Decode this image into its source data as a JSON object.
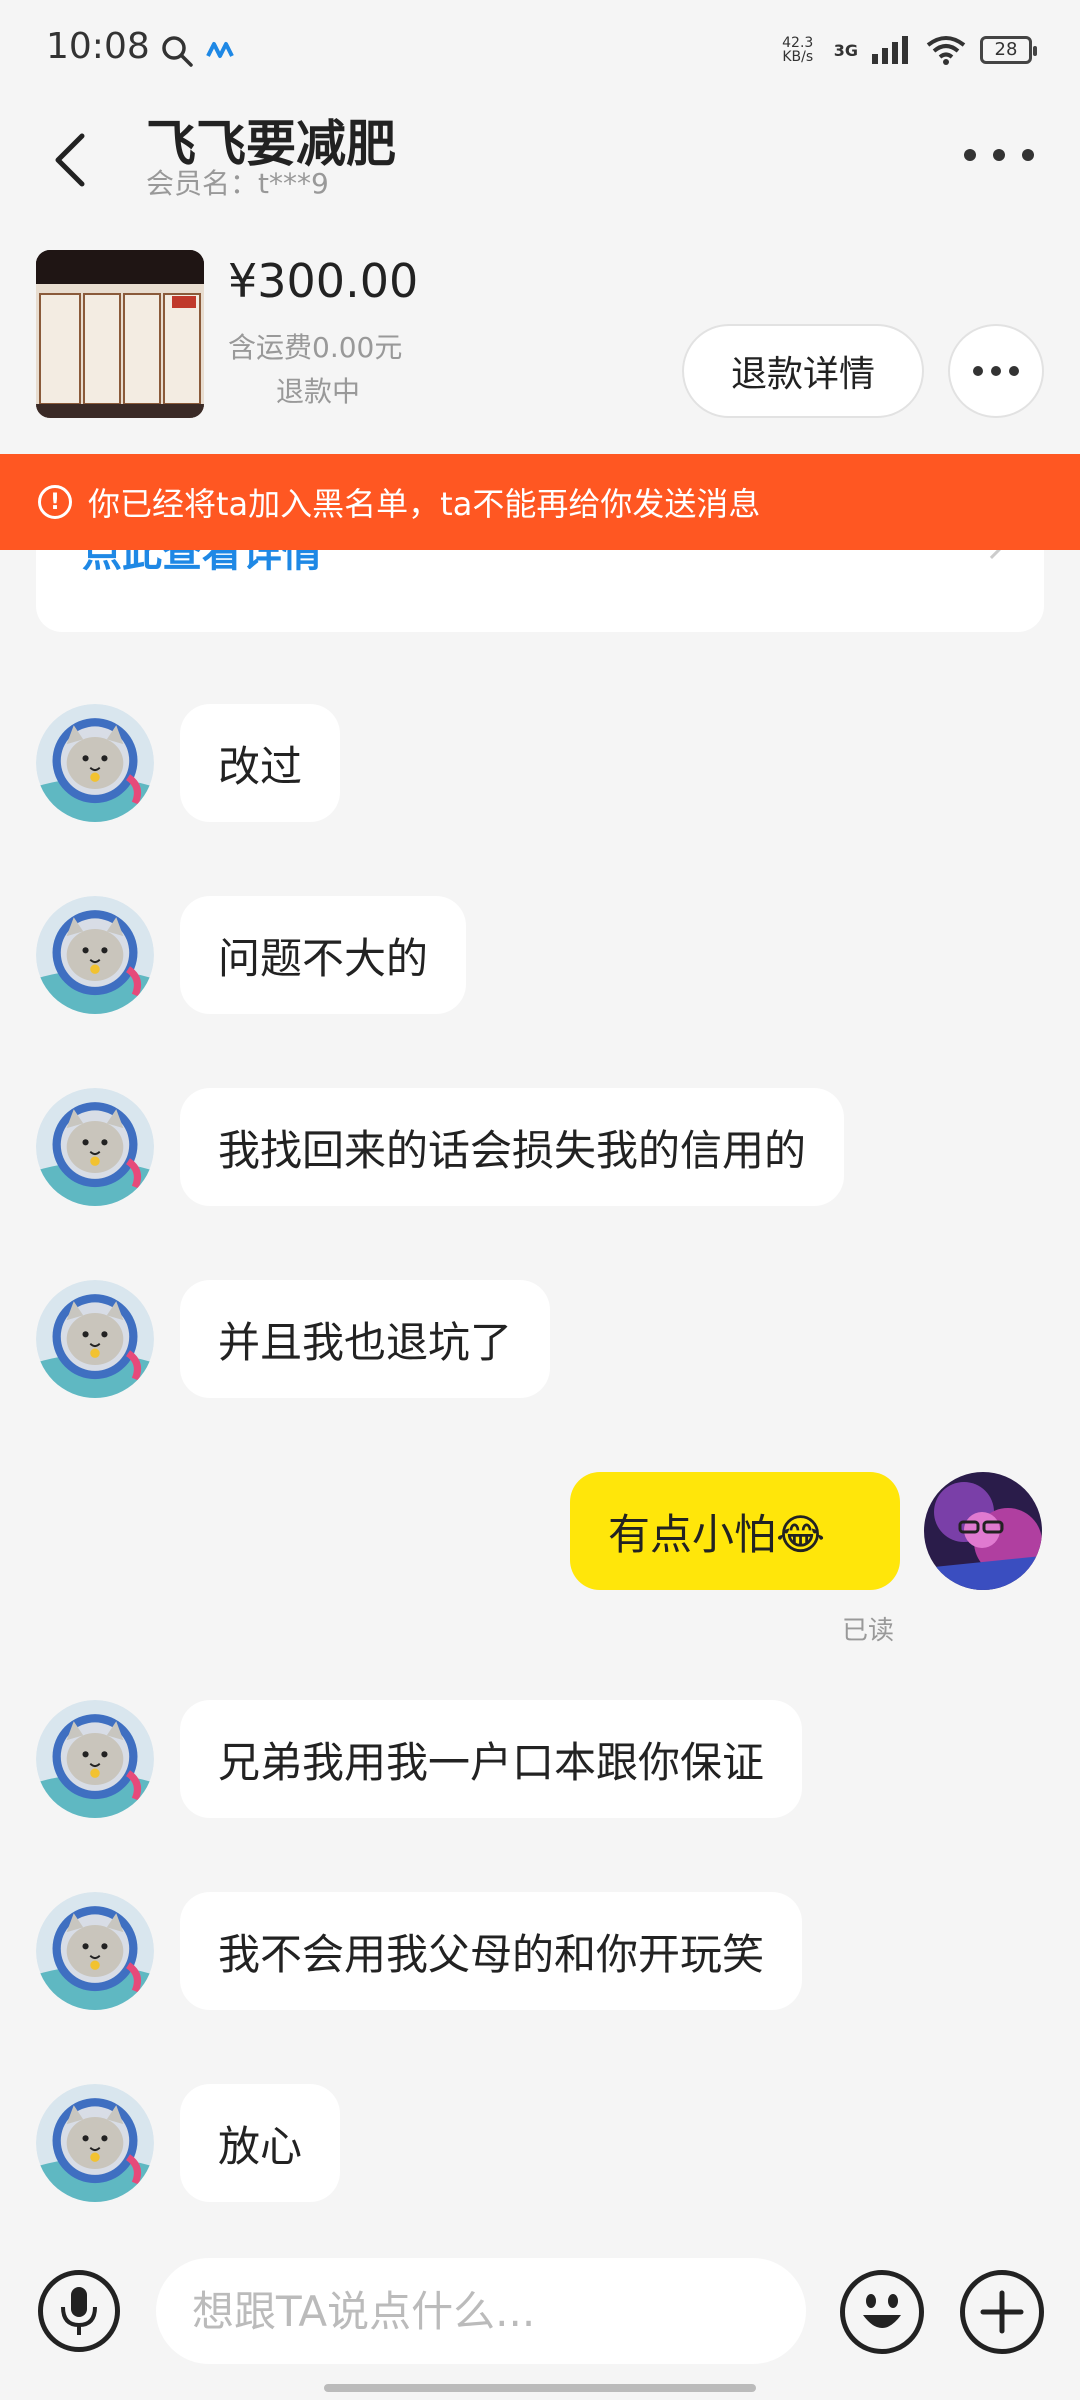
{
  "status_bar": {
    "time": "10:08",
    "net_speed_value": "42.3",
    "net_speed_unit": "KB/s",
    "network": "3G",
    "battery": "28"
  },
  "header": {
    "title": "飞飞要减肥",
    "subtitle": "会员名：t***9"
  },
  "product": {
    "price": "¥300.00",
    "shipping": "含运费0.00元",
    "status": "退款中",
    "refund_button": "退款详情"
  },
  "banner": {
    "text": "你已经将ta加入黑名单，ta不能再给你发送消息"
  },
  "hidden_card": {
    "link": "点此查看详情"
  },
  "messages": [
    {
      "from": "other",
      "text": "改过"
    },
    {
      "from": "other",
      "text": "问题不大的"
    },
    {
      "from": "other",
      "text": "我找回来的话会损失我的信用的"
    },
    {
      "from": "other",
      "text": "并且我也退坑了"
    },
    {
      "from": "me",
      "text": "有点小怕😂",
      "read": "已读"
    },
    {
      "from": "other",
      "text": "兄弟我用我一户口本跟你保证"
    },
    {
      "from": "other",
      "text": "我不会用我父母的和你开玩笑"
    },
    {
      "from": "other",
      "text": "放心"
    }
  ],
  "input": {
    "placeholder": "想跟TA说点什么..."
  },
  "colors": {
    "banner": "#ff5722",
    "my_bubble": "#ffe60a",
    "link": "#1e88e5"
  }
}
